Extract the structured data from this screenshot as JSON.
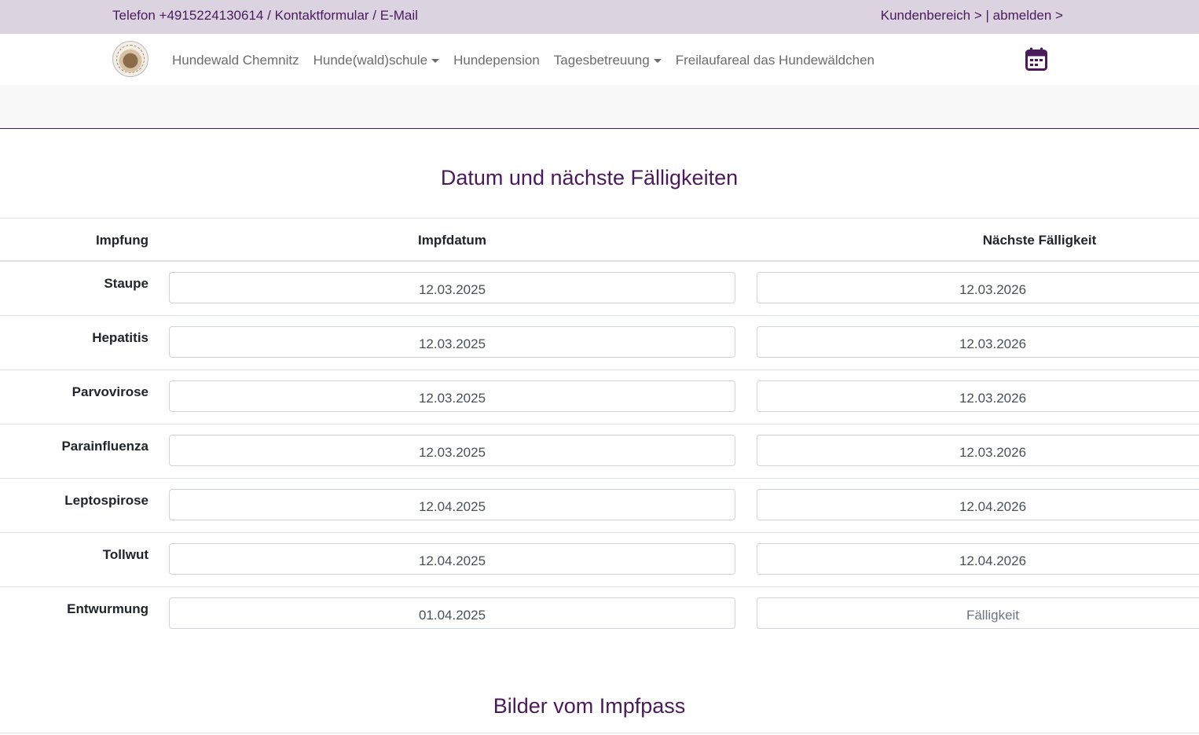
{
  "topbar": {
    "phone": "Telefon +4915224130614",
    "sep": " / ",
    "contact": "Kontaktformular",
    "email": "E-Mail",
    "customer_area": "Kundenbereich >",
    "logout": "| abmelden >"
  },
  "nav": {
    "items": [
      {
        "label": "Hundewald Chemnitz",
        "dropdown": false
      },
      {
        "label": "Hunde(wald)schule",
        "dropdown": true
      },
      {
        "label": "Hundepension",
        "dropdown": false
      },
      {
        "label": "Tagesbetreuung",
        "dropdown": true
      },
      {
        "label": "Freilaufareal das Hundewäldchen",
        "dropdown": false
      }
    ]
  },
  "colors": {
    "brand": "#4a1a5c",
    "topbar_bg": "#dcd3e0"
  },
  "section1": {
    "title": "Datum und nächste Fälligkeiten"
  },
  "table": {
    "headers": {
      "vaccine": "Impfung",
      "date": "Impfdatum",
      "next_due": "Nächste Fälligkeit"
    },
    "rows": [
      {
        "vaccine": "Staupe",
        "date": "12.03.2025",
        "next_due": "12.03.2026"
      },
      {
        "vaccine": "Hepatitis",
        "date": "12.03.2025",
        "next_due": "12.03.2026"
      },
      {
        "vaccine": "Parvovirose",
        "date": "12.03.2025",
        "next_due": "12.03.2026"
      },
      {
        "vaccine": "Parainfluenza",
        "date": "12.03.2025",
        "next_due": "12.03.2026"
      },
      {
        "vaccine": "Leptospirose",
        "date": "12.04.2025",
        "next_due": "12.04.2026"
      },
      {
        "vaccine": "Tollwut",
        "date": "12.04.2025",
        "next_due": "12.04.2026"
      },
      {
        "vaccine": "Entwurmung",
        "date": "01.04.2025",
        "next_due": "",
        "next_due_placeholder": "Fälligkeit"
      }
    ]
  },
  "section2": {
    "title": "Bilder vom Impfpass"
  },
  "icons": {
    "logo": "logo-image",
    "calendar": "calendar-icon"
  }
}
